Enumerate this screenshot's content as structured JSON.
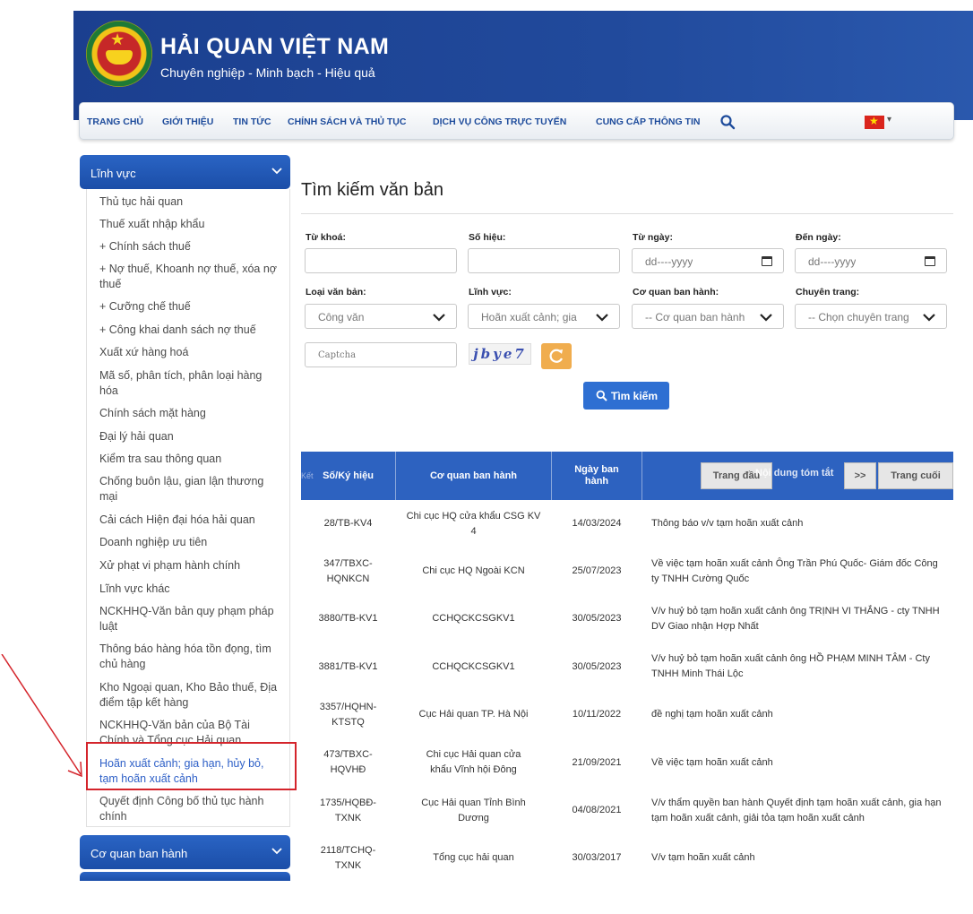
{
  "header": {
    "title": "HẢI QUAN VIỆT NAM",
    "subtitle": "Chuyên nghiệp - Minh bạch - Hiệu quả"
  },
  "nav": {
    "items": [
      "TRANG CHỦ",
      "GIỚI THIỆU",
      "TIN TỨC",
      "CHÍNH SÁCH VÀ THỦ TỤC",
      "DỊCH VỤ CÔNG TRỰC TUYẾN",
      "CUNG CẤP THÔNG TIN"
    ],
    "search_icon": "search-icon",
    "language_icon": "vietnam-flag-icon"
  },
  "sidebar": {
    "section1": "Lĩnh vực",
    "items": [
      "Thủ tục hải quan",
      "Thuế xuất nhập khẩu",
      "+ Chính sách thuế",
      "+ Nợ thuế, Khoanh nợ thuế, xóa nợ thuế",
      "+ Cưỡng chế thuế",
      "+ Công khai danh sách nợ thuế",
      "Xuất xứ hàng hoá",
      "Mã số, phân tích, phân loại hàng hóa",
      "Chính sách mặt hàng",
      "Đại lý hải quan",
      "Kiểm tra sau thông quan",
      "Chống buôn lậu, gian lận thương mại",
      "Cải cách Hiện đại hóa hải quan",
      "Doanh nghiệp ưu tiên",
      "Xử phạt vi phạm hành chính",
      "Lĩnh vực khác",
      "NCKHHQ-Văn bản quy phạm pháp luật",
      "Thông báo hàng hóa tồn đọng, tìm chủ hàng",
      "Kho Ngoại quan, Kho Bảo thuế, Địa điểm tập kết hàng",
      "NCKHHQ-Văn bản của Bộ Tài Chính và Tổng cục Hải quan",
      "Hoãn xuất cảnh; gia hạn, hủy bỏ, tạm hoãn xuất cảnh",
      "Quyết định Công bố thủ tục hành chính"
    ],
    "section2": "Cơ quan ban hành"
  },
  "main": {
    "title": "Tìm kiếm văn bản",
    "form": {
      "keyword_label": "Từ khoá:",
      "number_label": "Số hiệu:",
      "from_date_label": "Từ ngày:",
      "to_date_label": "Đến ngày:",
      "date_placeholder": "dd----yyyy",
      "doc_type_label": "Loại văn bản:",
      "doc_type_value": "Công văn",
      "field_label": "Lĩnh vực:",
      "field_value": "Hoãn xuất cảnh; gia",
      "agency_label": "Cơ quan ban hành:",
      "agency_value": "-- Cơ quan ban hành",
      "topic_label": "Chuyên trang:",
      "topic_value": "-- Chọn chuyên trang",
      "captcha_placeholder": "Captcha",
      "captcha_text": "jbye7",
      "search_button": "Tìm kiếm"
    },
    "table": {
      "headers": [
        "Số/Ký hiệu",
        "Cơ quan ban hành",
        "Ngày ban hành",
        "Nội dung tóm tắt"
      ],
      "ghost_text": "Kết",
      "pager": {
        "first": "Trang đầu",
        "next": ">>",
        "last": "Trang cuối"
      },
      "rows": [
        {
          "number": "28/TB-KV4",
          "agency": "Chi cục HQ cửa khẩu CSG KV 4",
          "date": "14/03/2024",
          "summary": "Thông báo v/v tạm hoãn xuất cảnh"
        },
        {
          "number": "347/TBXC-HQNKCN",
          "agency": "Chi cục HQ Ngoài KCN",
          "date": "25/07/2023",
          "summary": "Về việc tạm hoãn xuất cảnh Ông Trần Phú Quốc- Giám đốc Công ty TNHH Cường Quốc"
        },
        {
          "number": "3880/TB-KV1",
          "agency": "CCHQCKCSGKV1",
          "date": "30/05/2023",
          "summary": "V/v huỷ bỏ tạm hoãn xuất cảnh ông TRỊNH VI THẮNG - cty TNHH DV Giao nhận Hợp Nhất"
        },
        {
          "number": "3881/TB-KV1",
          "agency": "CCHQCKCSGKV1",
          "date": "30/05/2023",
          "summary": "V/v huỷ bỏ tạm hoãn xuất cảnh ông HỒ PHẠM MINH TÂM - Cty TNHH Minh Thái Lộc"
        },
        {
          "number": "3357/HQHN-KTSTQ",
          "agency": "Cục Hải quan TP. Hà Nội",
          "date": "10/11/2022",
          "summary": "đề nghị tạm hoãn xuất cảnh"
        },
        {
          "number": "473/TBXC-HQVHĐ",
          "agency": "Chi cục Hải quan cửa khẩu Vĩnh hội Đông",
          "date": "21/09/2021",
          "summary": "Về việc tạm hoãn xuất cảnh"
        },
        {
          "number": "1735/HQBĐ-TXNK",
          "agency": "Cục Hải quan Tỉnh Bình Dương",
          "date": "04/08/2021",
          "summary": "V/v thẩm quyền ban hành Quyết định tạm hoãn xuất cảnh, gia hạn tạm hoãn xuất cảnh, giải tỏa tạm hoãn xuất cảnh"
        },
        {
          "number": "2118/TCHQ-TXNK",
          "agency": "Tổng cục hải quan",
          "date": "30/03/2017",
          "summary": "V/v tạm hoãn xuất cảnh"
        }
      ]
    }
  }
}
